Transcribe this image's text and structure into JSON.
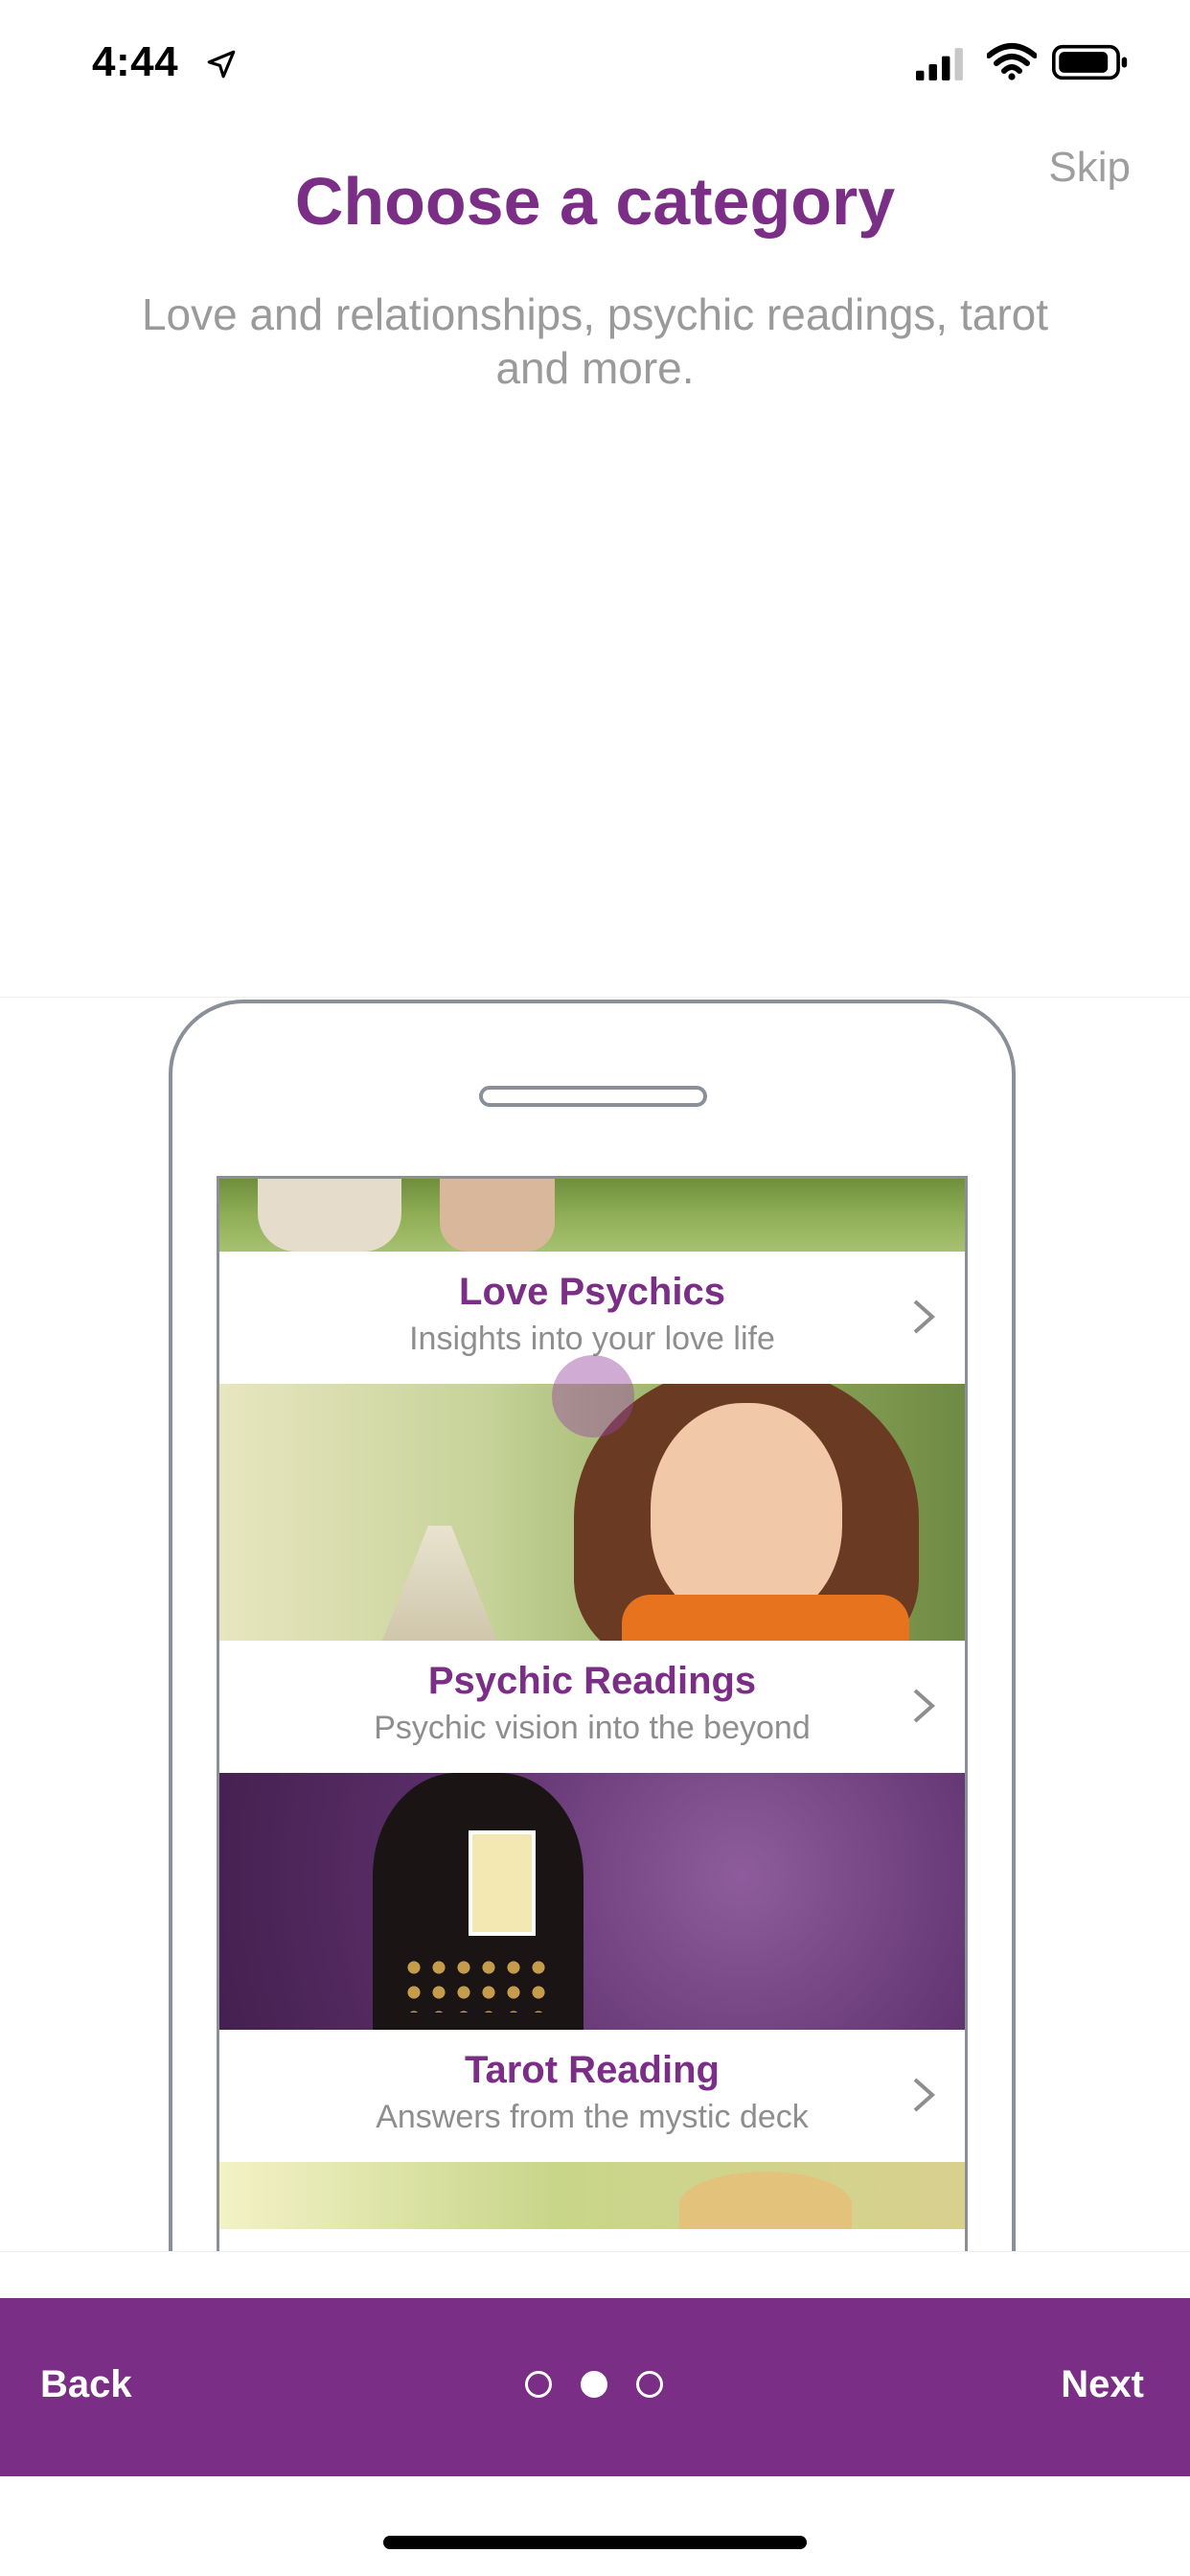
{
  "status_bar": {
    "time": "4:44",
    "icons": [
      "location-arrow-icon",
      "cellular-signal-icon",
      "wifi-icon",
      "battery-icon"
    ]
  },
  "header": {
    "skip_label": "Skip",
    "title": "Choose a category",
    "subtitle": "Love and relationships, psychic readings, tarot and more."
  },
  "illustration": {
    "categories": [
      {
        "title": "Love Psychics",
        "description": "Insights into your love life"
      },
      {
        "title": "Psychic Readings",
        "description": "Psychic vision into the beyond"
      },
      {
        "title": "Tarot Reading",
        "description": "Answers from the mystic deck"
      }
    ]
  },
  "bottom_nav": {
    "back_label": "Back",
    "next_label": "Next",
    "page_indicator": {
      "total": 3,
      "active_index": 1
    }
  },
  "colors": {
    "brand_purple": "#7b2e85",
    "muted_text": "#9a9a9a",
    "white": "#ffffff"
  }
}
